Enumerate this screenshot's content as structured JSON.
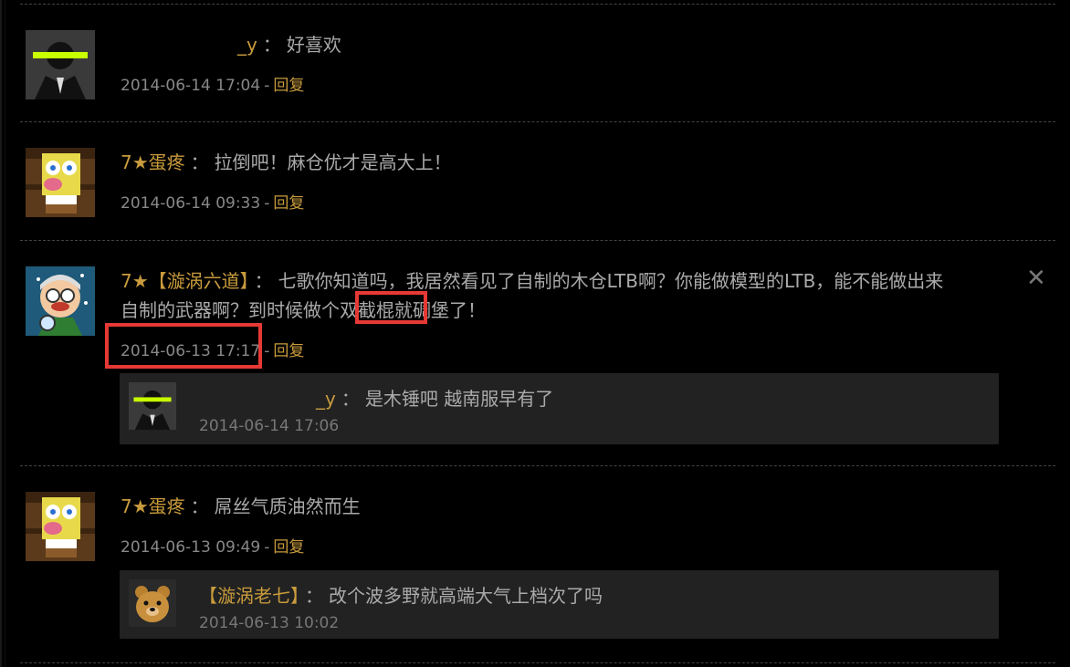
{
  "reply_label": "回复",
  "comments": [
    {
      "user": "_y",
      "text": "好喜欢",
      "time": "2014-06-14 17:04"
    },
    {
      "user": "7★蛋疼",
      "text": "拉倒吧！麻仓优才是高大上！",
      "time": "2014-06-14 09:33"
    },
    {
      "user": "7★【漩涡六道】",
      "text_line1": "七歌你知道吗，我居然看见了自制的木仓LTB啊？你能做模型的LTB，能不能做出来",
      "text_line2_a": "自制的武器啊？到时候做个",
      "text_line2_hl": "双截棍",
      "text_line2_b": "就碉堡了！",
      "time": "2014-06-13 17:17",
      "close_icon": "✕",
      "sub": {
        "user": "_y",
        "text": "是木锤吧 越南服早有了",
        "time": "2014-06-14 17:06"
      }
    },
    {
      "user": "7★蛋疼",
      "text": "屌丝气质油然而生",
      "time": "2014-06-13 09:49",
      "sub": {
        "user": "【漩涡老七】",
        "text": "改个波多野就高端大气上档次了吗",
        "time": "2014-06-13 10:02"
      }
    }
  ],
  "colors": {
    "background": "#000000",
    "username": "#c89b3c",
    "text": "#aaaaaa",
    "highlight": "#e53935"
  }
}
